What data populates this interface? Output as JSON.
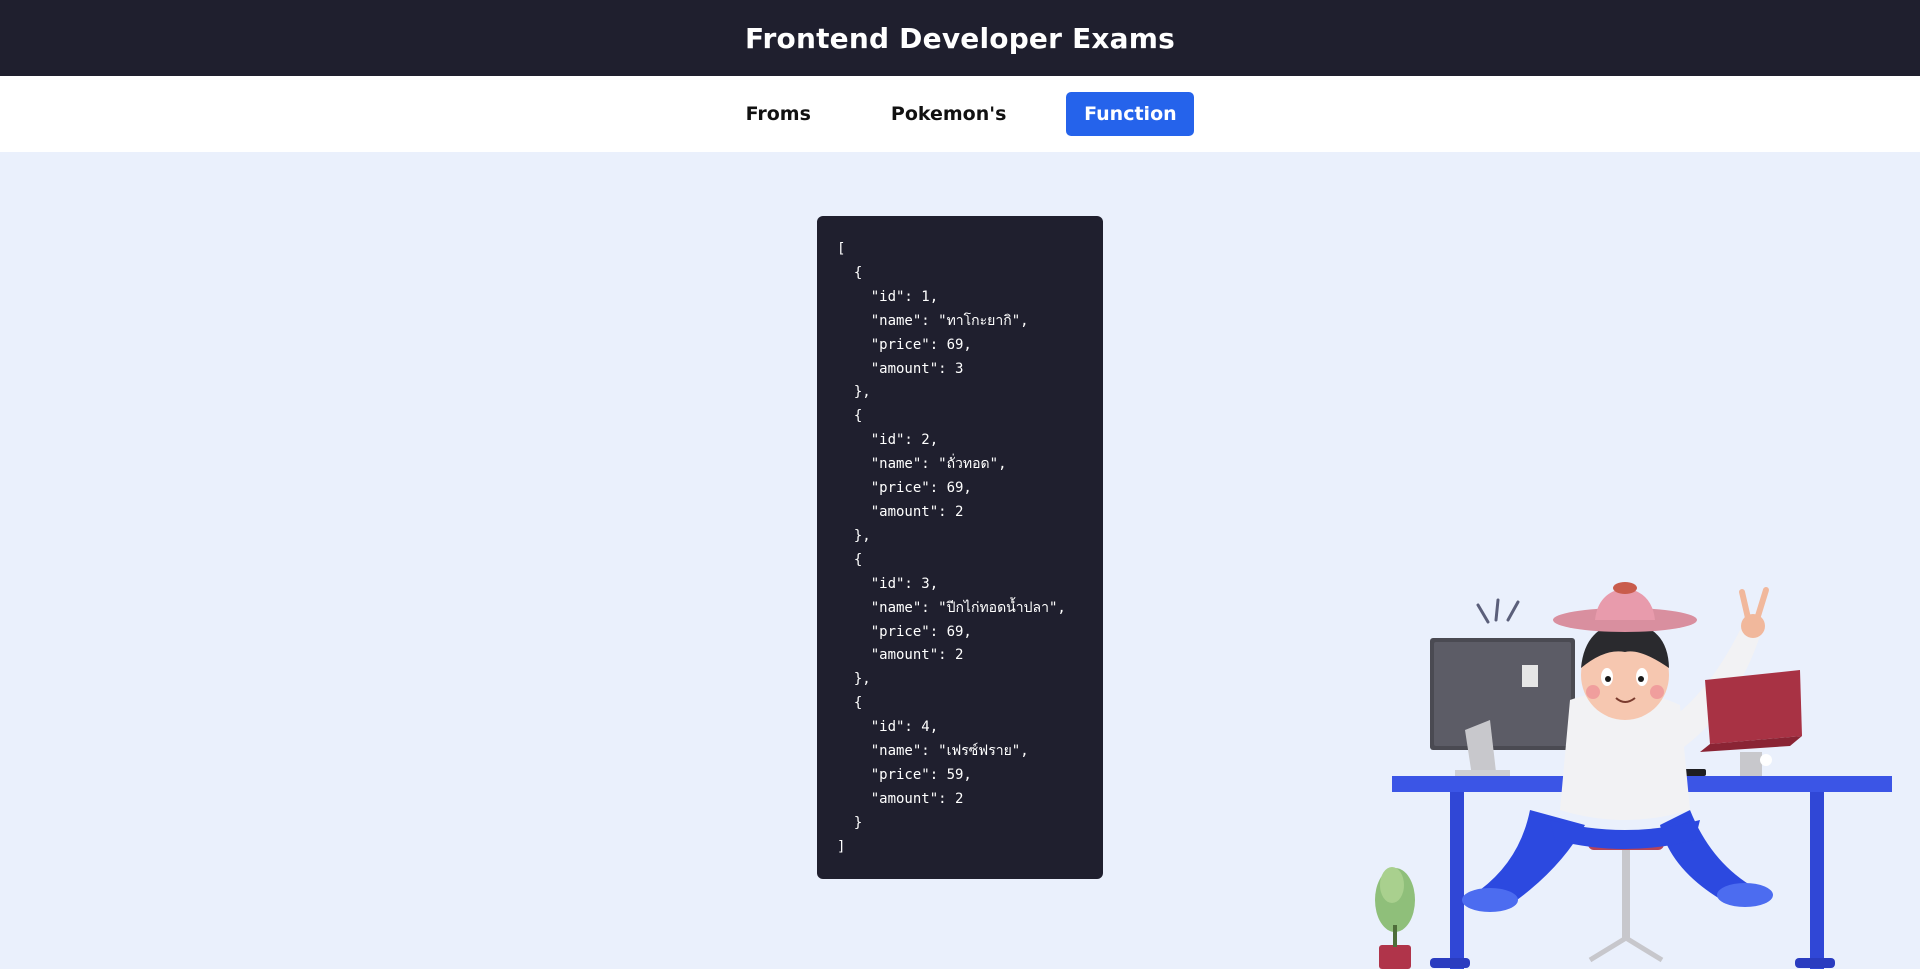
{
  "header": {
    "title": "Frontend Developer Exams"
  },
  "nav": {
    "tabs": [
      {
        "label": "Froms",
        "active": false
      },
      {
        "label": "Pokemon's",
        "active": false
      },
      {
        "label": "Function",
        "active": true
      }
    ]
  },
  "colors": {
    "header_bg": "#1f1f2e",
    "page_bg": "#eaf0fc",
    "accent": "#2563eb",
    "code_bg": "#1f1f2e"
  },
  "code_output": "[\n  {\n    \"id\": 1,\n    \"name\": \"ทาโกะยากิ\",\n    \"price\": 69,\n    \"amount\": 3\n  },\n  {\n    \"id\": 2,\n    \"name\": \"ถั่วทอด\",\n    \"price\": 69,\n    \"amount\": 2\n  },\n  {\n    \"id\": 3,\n    \"name\": \"ปีกไก่ทอดน้ำปลา\",\n    \"price\": 69,\n    \"amount\": 2\n  },\n  {\n    \"id\": 4,\n    \"name\": \"เฟรซ์ฟราย\",\n    \"price\": 59,\n    \"amount\": 2\n  }\n]"
}
